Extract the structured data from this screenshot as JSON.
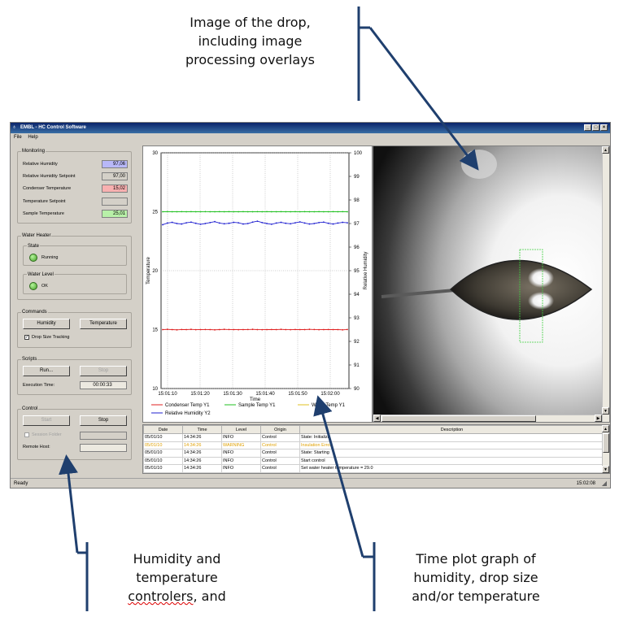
{
  "annotations": {
    "drop_image": [
      "Image of the drop,",
      "including image",
      "processing overlays"
    ],
    "controllers": [
      "Humidity and",
      "temperature",
      "controlers, and"
    ],
    "timeplot": [
      "Time plot graph of",
      "humidity, drop size",
      "and/or temperature"
    ]
  },
  "window": {
    "title": "EMBL - HC Control Software",
    "menu": [
      "File",
      "Help"
    ],
    "status": "Ready",
    "clock": "15:02:08"
  },
  "monitoring": {
    "title": "Monitoring",
    "rows": [
      {
        "label": "Relative Humidity",
        "value": "97,06",
        "color": "#b8b8f8"
      },
      {
        "label": "Relative Humidity Setpoint",
        "value": "97,00",
        "color": "#d4d0c8"
      },
      {
        "label": "Condenser Temperature",
        "value": "15,02",
        "color": "#f8b0b0"
      },
      {
        "label": "Temperature Setpoint",
        "value": "",
        "color": "#d4d0c8"
      },
      {
        "label": "Sample Temperature",
        "value": "25,01",
        "color": "#b8f0a8"
      }
    ]
  },
  "water_heater": {
    "title": "Water Heater",
    "state_title": "State",
    "state_value": "Running",
    "level_title": "Water Level",
    "level_value": "OK"
  },
  "commands": {
    "title": "Commands",
    "humidity": "Humidity",
    "temperature": "Temperature",
    "tracking": "Drop Size Tracking"
  },
  "scripts": {
    "title": "Scripts",
    "run": "Run...",
    "stop": "Stop",
    "exec_label": "Execution Time:",
    "exec_value": "00:00:33"
  },
  "control": {
    "title": "Control",
    "start": "Start",
    "stop": "Stop",
    "session": "Session Folder",
    "remote": "Remote Host:"
  },
  "chart_data": {
    "type": "line",
    "xlabel": "Time",
    "ylabel": "Temperature",
    "y2label": "Relative Humidity",
    "x_ticks": [
      "15:01:10",
      "15:01:20",
      "15:01:30",
      "15:01:40",
      "15:01:50",
      "15:02:00"
    ],
    "ylim": [
      10,
      30
    ],
    "y_ticks": [
      "10",
      "15",
      "20",
      "25",
      "30"
    ],
    "y2lim": [
      90,
      100
    ],
    "y2_ticks": [
      "90",
      "91",
      "92",
      "93",
      "94",
      "95",
      "96",
      "97",
      "98",
      "99",
      "100"
    ],
    "grid": true,
    "legend": "bottom",
    "series": [
      {
        "name": "Condenser Temp Y1",
        "axis": "y1",
        "color": "#e02020",
        "values": [
          15.0,
          15.02,
          15.0,
          14.98,
          15.01,
          15.0,
          15.02,
          14.99,
          15.0,
          15.01,
          15.0,
          14.98,
          15.0,
          15.02,
          15.01,
          15.0,
          14.99,
          15.0,
          15.01,
          15.02,
          15.0,
          14.99,
          15.0,
          15.01,
          15.0,
          15.02,
          15.0,
          14.99,
          15.01,
          15.0,
          15.0,
          15.02,
          15.01,
          14.99,
          15.0,
          15.01,
          15.0,
          15.0,
          14.98,
          15.01
        ]
      },
      {
        "name": "Sample Temp Y1",
        "axis": "y1",
        "color": "#20c020",
        "values": [
          25.0,
          25.01,
          25.0,
          25.0,
          25.01,
          25.0,
          25.01,
          25.0,
          25.0,
          25.01,
          25.0,
          25.0,
          25.01,
          25.0,
          25.01,
          25.0,
          25.0,
          25.01,
          25.0,
          25.0,
          25.01,
          25.0,
          25.01,
          25.0,
          25.0,
          25.01,
          25.0,
          25.0,
          25.01,
          25.0,
          25.01,
          25.0,
          25.0,
          25.01,
          25.0,
          25.0,
          25.01,
          25.0,
          25.01,
          25.0
        ]
      },
      {
        "name": "Water Temp Y1",
        "axis": "y1",
        "color": "#e0c020",
        "values": []
      },
      {
        "name": "Relative Humidity Y2",
        "axis": "y2",
        "color": "#2020d0",
        "values": [
          96.95,
          97.02,
          97.05,
          97.0,
          96.98,
          97.03,
          97.06,
          97.01,
          96.97,
          97.0,
          97.04,
          97.08,
          97.02,
          96.99,
          97.01,
          97.05,
          97.03,
          96.98,
          97.0,
          97.06,
          97.1,
          97.04,
          97.0,
          96.97,
          97.02,
          97.05,
          97.01,
          96.99,
          97.03,
          97.07,
          97.02,
          96.98,
          97.0,
          97.04,
          97.06,
          97.01,
          96.98,
          97.02,
          97.05,
          97.03
        ]
      }
    ]
  },
  "log": {
    "columns": [
      "Date",
      "Time",
      "Level",
      "Origin",
      "Description"
    ],
    "rows": [
      {
        "date": "05/01/10",
        "time": "14:34:26",
        "level": "INFO",
        "origin": "Control",
        "desc": "State: Initializi"
      },
      {
        "date": "05/01/10",
        "time": "14:34:26",
        "level": "WARNING",
        "origin": "Control",
        "desc": "Insulation Error",
        "warn": true
      },
      {
        "date": "05/01/10",
        "time": "14:34:26",
        "level": "INFO",
        "origin": "Control",
        "desc": "State: Starting"
      },
      {
        "date": "05/01/10",
        "time": "14:34:26",
        "level": "INFO",
        "origin": "Control",
        "desc": "Start control"
      },
      {
        "date": "05/01/10",
        "time": "14:34:26",
        "level": "INFO",
        "origin": "Control",
        "desc": "Set water heater temperature = 29.0"
      }
    ]
  }
}
